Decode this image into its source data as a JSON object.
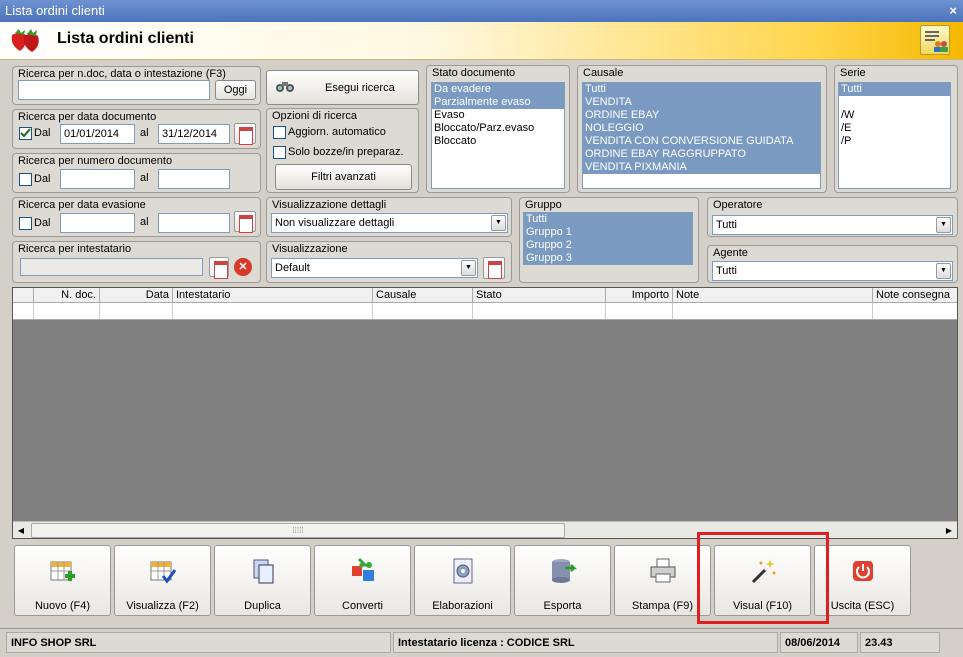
{
  "window": {
    "title": "Lista ordini clienti",
    "close_label": "×"
  },
  "header": {
    "title": "Lista ordini clienti"
  },
  "search_text": {
    "caption": "Ricerca per n.doc, data o intestazione (F3)",
    "value": "",
    "today_button": "Oggi"
  },
  "search_button": "Esegui ricerca",
  "search_date": {
    "caption": "Ricerca per data documento",
    "from_label": "Dal",
    "from_checked": true,
    "from_value": "01/01/2014",
    "to_label": "al",
    "to_value": "31/12/2014"
  },
  "search_number": {
    "caption": "Ricerca per numero documento",
    "from_label": "Dal",
    "from_value": "",
    "to_label": "al",
    "to_value": ""
  },
  "search_evasion": {
    "caption": "Ricerca per data evasione",
    "from_label": "Dal",
    "from_value": "",
    "to_label": "al",
    "to_value": ""
  },
  "search_holder": {
    "caption": "Ricerca per intestatario",
    "value": ""
  },
  "search_options": {
    "caption": "Opzioni di ricerca",
    "auto_update": "Aggiorn. automatico",
    "drafts_only": "Solo bozze/in preparaz.",
    "advanced_filters": "Filtri avanzati"
  },
  "status": {
    "caption": "Stato documento",
    "items": [
      {
        "label": "Da evadere",
        "selected": true
      },
      {
        "label": "Parzialmente evaso",
        "selected": true
      },
      {
        "label": "Evaso",
        "selected": false
      },
      {
        "label": "Bloccato/Parz.evaso",
        "selected": false
      },
      {
        "label": "Bloccato",
        "selected": false
      }
    ]
  },
  "causale": {
    "caption": "Causale",
    "items": [
      "Tutti",
      "VENDITA",
      "ORDINE EBAY",
      "NOLEGGIO",
      "VENDITA CON CONVERSIONE GUIDATA",
      "ORDINE EBAY RAGGRUPPATO",
      "VENDITA PIXMANIA"
    ]
  },
  "serie": {
    "caption": "Serie",
    "items": [
      {
        "label": "Tutti",
        "selected": true
      },
      {
        "label": "",
        "selected": false
      },
      {
        "label": "/W",
        "selected": false
      },
      {
        "label": "/E",
        "selected": false
      },
      {
        "label": "/P",
        "selected": false
      }
    ]
  },
  "details": {
    "caption": "Visualizzazione dettagli",
    "value": "Non visualizzare dettagli"
  },
  "view": {
    "caption": "Visualizzazione",
    "value": "Default"
  },
  "gruppo": {
    "caption": "Gruppo",
    "items": [
      "Tutti",
      "Gruppo 1",
      "Gruppo 2",
      "Gruppo 3"
    ]
  },
  "operatore": {
    "caption": "Operatore",
    "value": "Tutti"
  },
  "agente": {
    "caption": "Agente",
    "value": "Tutti"
  },
  "grid": {
    "columns": [
      "N. doc.",
      "Data",
      "Intestatario",
      "Causale",
      "Stato",
      "Importo",
      "Note",
      "Note consegna"
    ]
  },
  "toolbar": [
    {
      "label": "Nuovo (F4)",
      "icon": "grid-add-icon"
    },
    {
      "label": "Visualizza (F2)",
      "icon": "grid-check-icon"
    },
    {
      "label": "Duplica",
      "icon": "duplicate-icon"
    },
    {
      "label": "Converti",
      "icon": "convert-icon"
    },
    {
      "label": "Elaborazioni",
      "icon": "gears-icon"
    },
    {
      "label": "Esporta",
      "icon": "database-export-icon"
    },
    {
      "label": "Stampa (F9)",
      "icon": "printer-icon"
    },
    {
      "label": "Visual (F10)",
      "icon": "magic-wand-icon"
    },
    {
      "label": "Uscita (ESC)",
      "icon": "power-icon"
    }
  ],
  "status_bar": {
    "company": "INFO SHOP SRL",
    "license": "Intestatario licenza : CODICE SRL",
    "date": "08/06/2014",
    "time": "23.43"
  },
  "colors": {
    "title_bar": "#4c74bd",
    "selection": "#7b9ac2",
    "highlight_border": "#e02020",
    "header_gradient_end": "#f5b800"
  }
}
